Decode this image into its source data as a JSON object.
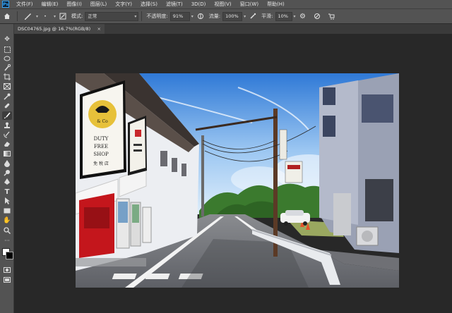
{
  "app": {
    "logo": "Ps",
    "menu": [
      "文件(F)",
      "编辑(E)",
      "图像(I)",
      "图层(L)",
      "文字(Y)",
      "选择(S)",
      "滤镜(T)",
      "3D(D)",
      "视图(V)",
      "窗口(W)",
      "帮助(H)"
    ]
  },
  "options_bar": {
    "mode_label": "模式:",
    "mode_value": "正常",
    "opacity_label": "不透明度:",
    "opacity_value": "91%",
    "flow_label": "流量:",
    "flow_value": "100%",
    "smoothing_label": "平滑:",
    "smoothing_value": "10%"
  },
  "document": {
    "tab_title": "DSC04765.jpg @ 16.7%(RGB/8)",
    "close_glyph": "×"
  },
  "photo_signs": {
    "billboard_main": [
      "DUTY",
      "FREE",
      "SHOP"
    ],
    "billboard_logo_text": "& Co",
    "billboard_sub": "免 税 店"
  },
  "colors": {
    "chrome": "#535353",
    "canvas_bg": "#282828",
    "ps_blue": "#31a8ff"
  }
}
